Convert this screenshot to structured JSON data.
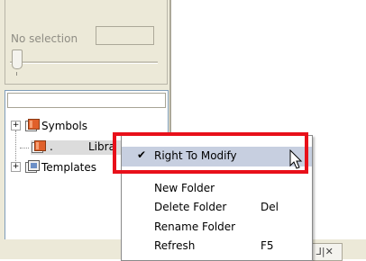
{
  "selection": {
    "label": "No selection",
    "field_value": ""
  },
  "tree": {
    "items": [
      {
        "label": "Symbols",
        "expander": "+"
      },
      {
        "label": ".",
        "suffix": "Libra"
      },
      {
        "label": "Templates",
        "expander": "+"
      }
    ]
  },
  "context_menu": {
    "items": [
      {
        "label": "Right To Modify",
        "checked": true,
        "shortcut": ""
      },
      {
        "label": "New Folder",
        "shortcut": ""
      },
      {
        "label": "Delete Folder",
        "shortcut": "Del"
      },
      {
        "label": "Rename Folder",
        "shortcut": ""
      },
      {
        "label": "Refresh",
        "shortcut": "F5"
      }
    ]
  },
  "bottom": {
    "buttons_text": "ᒧ|✕"
  },
  "colors": {
    "highlight": "#e8101a",
    "menu_hover": "#c7cfe0",
    "folder": "#e0602a"
  }
}
